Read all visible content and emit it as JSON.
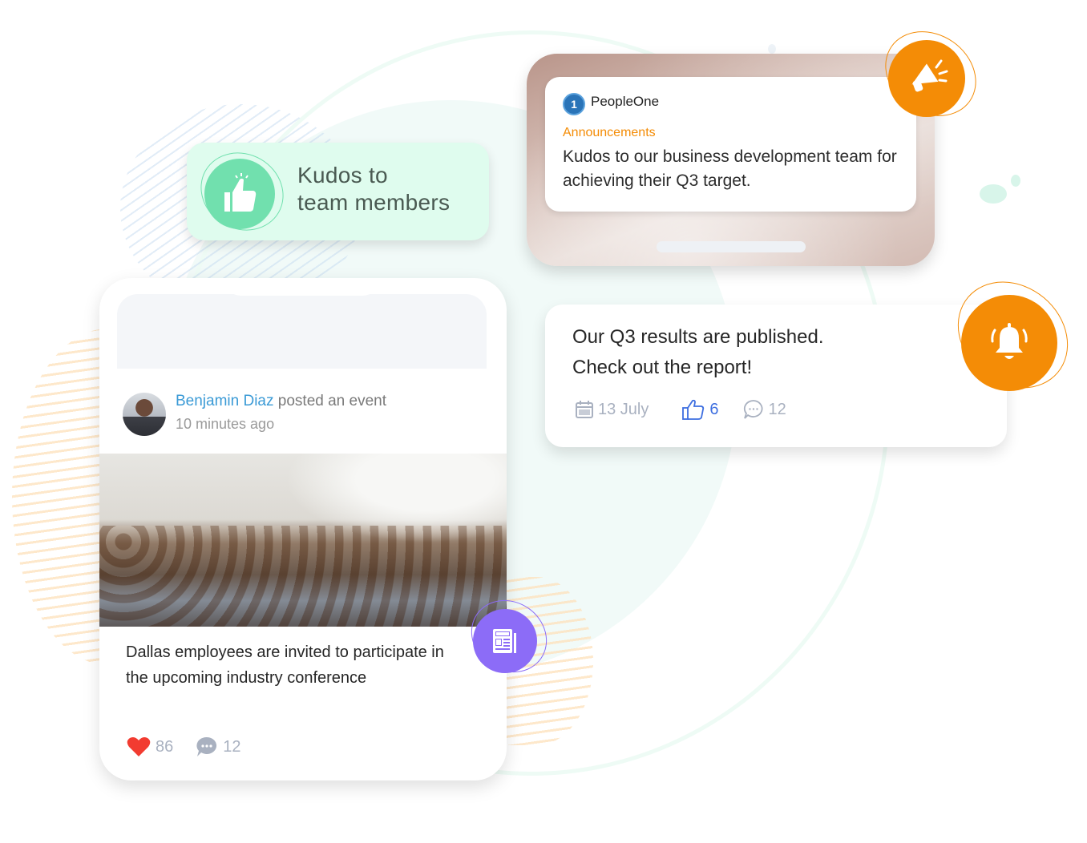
{
  "kudos_badge": {
    "line1": "Kudos to",
    "line2": "team members",
    "icon": "thumbs-up-icon",
    "color": "#71e0ae"
  },
  "announcement": {
    "brand": "PeopleOne",
    "brand_logo_glyph": "1",
    "category": "Announcements",
    "message": "Kudos to our business development team for achieving their Q3 target.",
    "icon": "megaphone-icon",
    "accent_color": "#f48c06"
  },
  "results_post": {
    "line1": "Our Q3 results are published.",
    "line2": "Check out the report!",
    "date": "13 July",
    "likes": "6",
    "comments": "12",
    "icon": "bell-icon"
  },
  "feed_post": {
    "author": "Benjamin Diaz",
    "action": " posted an event",
    "time": "10 minutes ago",
    "text": "Dallas employees are invited to participate in the upcoming industry conference",
    "hearts": "86",
    "comments": "12",
    "badge_icon": "newspaper-icon",
    "badge_color": "#8c6cf7"
  }
}
